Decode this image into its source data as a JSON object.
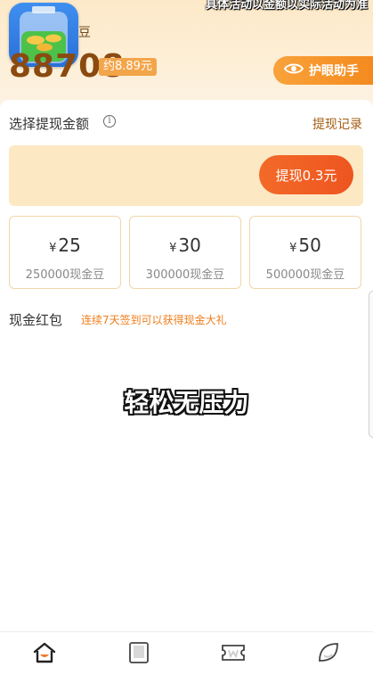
{
  "header": {
    "notice_text": "具体活动以金额以实际活动为准",
    "bean_unit": "豆",
    "balance": "88708",
    "approx_value": "约8.89元",
    "eye_assistant_label": "护眼助手"
  },
  "withdraw": {
    "section_title": "选择提现金额",
    "info_icon_glyph": "i",
    "record_link": "提现记录",
    "button_label": "提现0.3元",
    "options": [
      {
        "currency": "¥",
        "amount": "25",
        "beans": "250000现金豆"
      },
      {
        "currency": "¥",
        "amount": "30",
        "beans": "300000现金豆"
      },
      {
        "currency": "¥",
        "amount": "50",
        "beans": "500000现金豆"
      }
    ]
  },
  "red_packet": {
    "title": "现金红包",
    "note": "连续7天签到可以获得现金大礼"
  },
  "overlay": {
    "caption": "轻松无压力"
  },
  "bottom_nav": {
    "items": [
      {
        "icon": "home-icon",
        "active": true
      },
      {
        "icon": "book-icon",
        "active": false
      },
      {
        "icon": "ticket-icon",
        "active": false
      },
      {
        "icon": "leaf-icon",
        "active": false
      }
    ]
  },
  "colors": {
    "accent_orange": "#f36a28",
    "brown_text": "#8a4a10",
    "link_brown": "#a35d12",
    "note_orange": "#ef7d1a",
    "panel_bg": "#fde8c4"
  }
}
